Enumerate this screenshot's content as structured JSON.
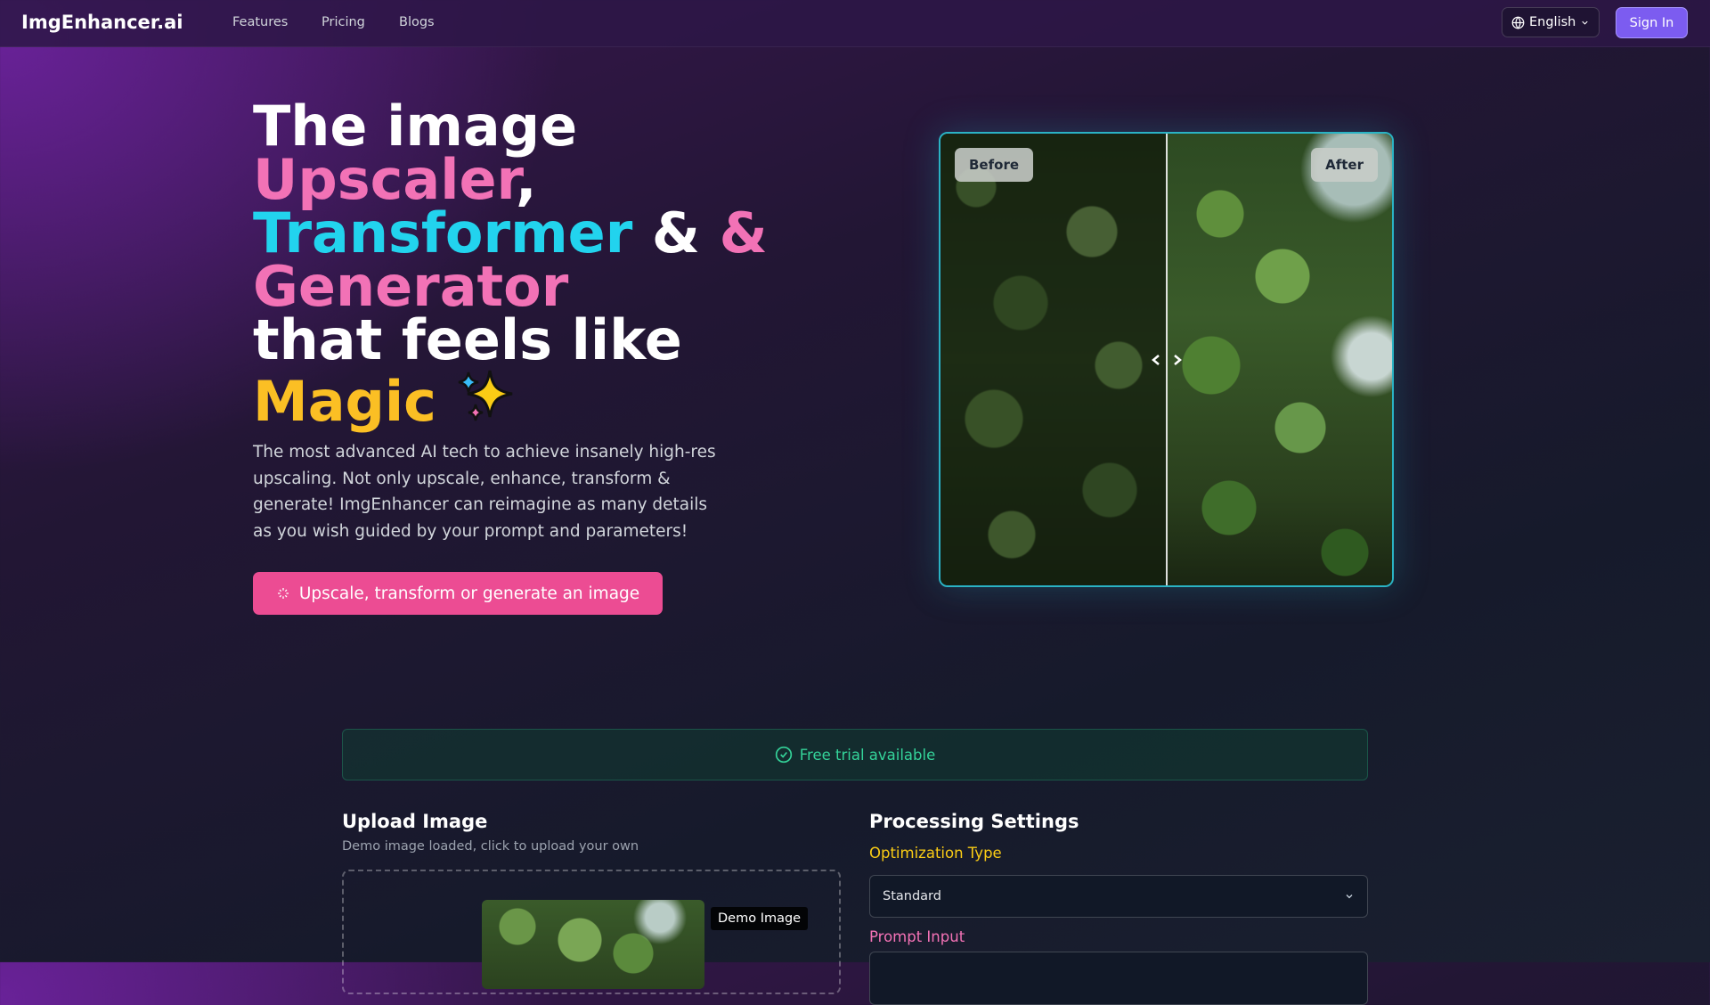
{
  "nav": {
    "brand": "ImgEnhancer.ai",
    "links": [
      "Features",
      "Pricing",
      "Blogs"
    ],
    "language": "English",
    "language_icon": "globe-icon",
    "sign_in": "Sign In"
  },
  "hero": {
    "line1": "The image",
    "word_upscaler": "Upscaler",
    "comma": ",",
    "word_transformer": "Transformer",
    "amp_white": "&",
    "amp_pink": "&",
    "word_generator": "Generator",
    "line5": "that feels like",
    "word_magic": "Magic",
    "sparkle_icon": "sparkles-icon",
    "description": "The most advanced AI tech to achieve insanely high-res upscaling. Not only upscale, enhance, transform & generate! ImgEnhancer can reimagine as many details as you wish guided by your prompt and parameters!",
    "cta_label": "Upscale, transform or generate an image",
    "cta_icon": "sparkle-icon",
    "colors": {
      "pink": "#f272b6",
      "cyan": "#22d3ee",
      "yellow": "#fbbf24",
      "cta": "#ec4c93",
      "accent": "#7c5cf0"
    }
  },
  "compare": {
    "before_label": "Before",
    "after_label": "After",
    "handle_icon": "left-right-arrows-icon"
  },
  "tool": {
    "trial_text": "Free trial available",
    "trial_icon": "check-circle-icon",
    "upload_title": "Upload Image",
    "upload_subtitle": "Demo image loaded, click to upload your own",
    "demo_image_label": "Demo Image",
    "settings_title": "Processing Settings",
    "optimization_label": "Optimization Type",
    "optimization_value": "Standard",
    "prompt_label": "Prompt Input"
  }
}
